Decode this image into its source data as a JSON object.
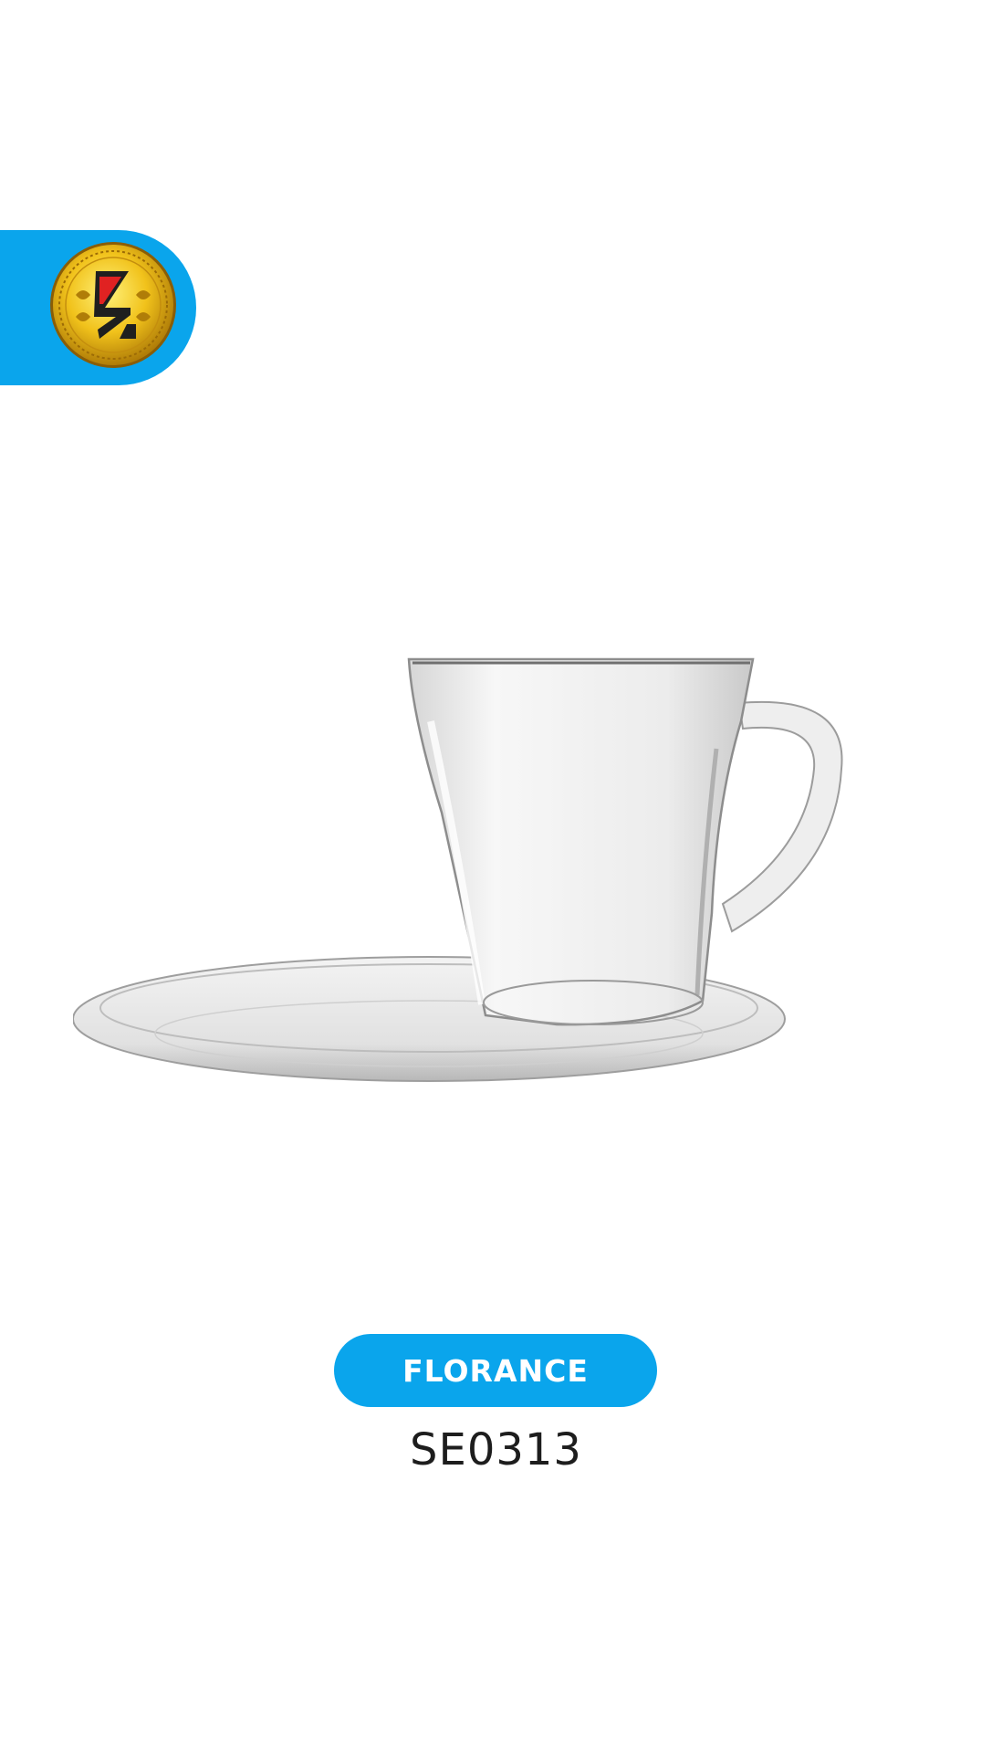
{
  "brand": {
    "tab_color": "#0aa5ec",
    "logo_icon": "gold-brand-medallion-icon"
  },
  "product": {
    "image_icon": "glass-cup-and-saucer-image",
    "name": "FLORANCE",
    "sku": "SE0313",
    "accent_color": "#0aa5ec"
  }
}
